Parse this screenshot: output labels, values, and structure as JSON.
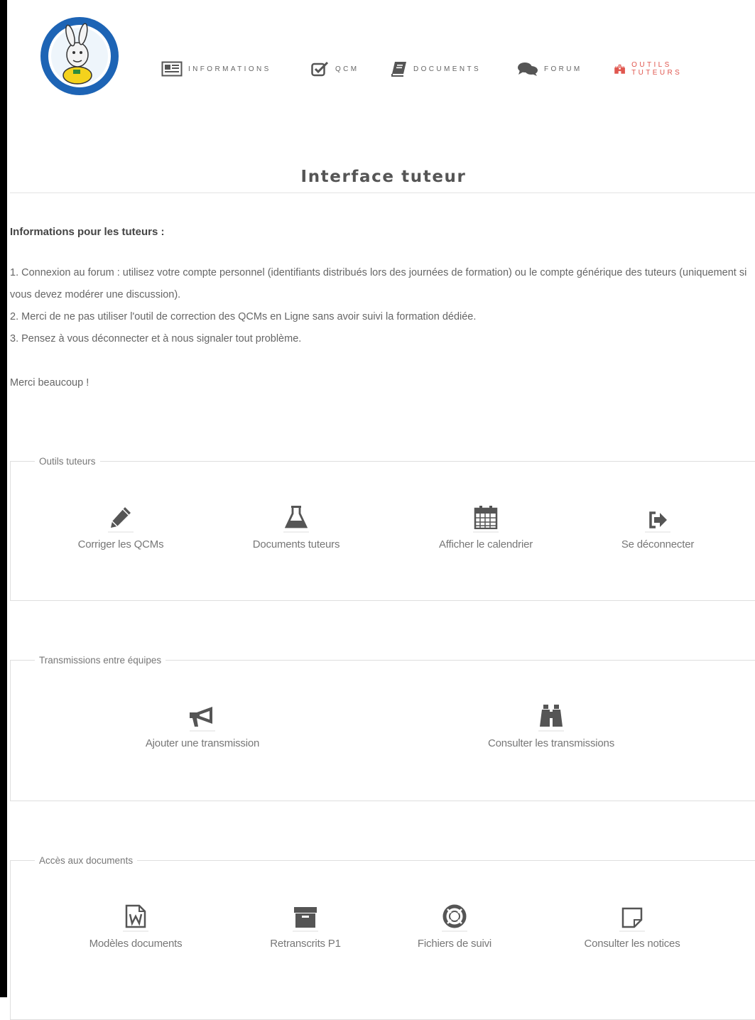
{
  "nav": {
    "informations": "INFORMATIONS",
    "qcm": "QCM",
    "documents": "DOCUMENTS",
    "forum": "FORUM",
    "outils": "OUTILS TUTEURS"
  },
  "page": {
    "title": "Interface tuteur"
  },
  "info": {
    "heading": "Informations pour les tuteurs :",
    "lines": [
      "1. Connexion au forum : utilisez votre compte personnel (identifiants distribués lors des journées de formation) ou le compte générique des tuteurs (uniquement si vous devez modérer une discussion).",
      "2. Merci de ne pas utiliser l'outil de correction des QCMs en Ligne sans avoir suivi la formation dédiée.",
      "3. Pensez à vous déconnecter et à nous signaler tout problème."
    ],
    "thanks": "Merci beaucoup !"
  },
  "groups": {
    "outils": {
      "legend": "Outils tuteurs",
      "items": [
        {
          "label": "Corriger les QCMs",
          "icon": "pencil-icon"
        },
        {
          "label": "Documents tuteurs",
          "icon": "flask-icon"
        },
        {
          "label": "Afficher le calendrier",
          "icon": "calendar-icon"
        },
        {
          "label": "Se déconnecter",
          "icon": "sign-out-icon"
        }
      ]
    },
    "transmissions": {
      "legend": "Transmissions entre équipes",
      "items": [
        {
          "label": "Ajouter une transmission",
          "icon": "bullhorn-icon"
        },
        {
          "label": "Consulter les transmissions",
          "icon": "binoculars-icon"
        }
      ]
    },
    "documents": {
      "legend": "Accès aux documents",
      "items": [
        {
          "label": "Modèles documents",
          "icon": "word-file-icon"
        },
        {
          "label": "Retranscrits P1",
          "icon": "archive-icon"
        },
        {
          "label": "Fichiers de suivi",
          "icon": "life-ring-icon"
        },
        {
          "label": "Consulter les notices",
          "icon": "sticky-note-icon"
        }
      ]
    }
  },
  "colors": {
    "accent": "#e0574f",
    "text": "#555555",
    "border": "#dedede",
    "logo_ring": "#1d64b5",
    "logo_yellow": "#f4d21c"
  }
}
